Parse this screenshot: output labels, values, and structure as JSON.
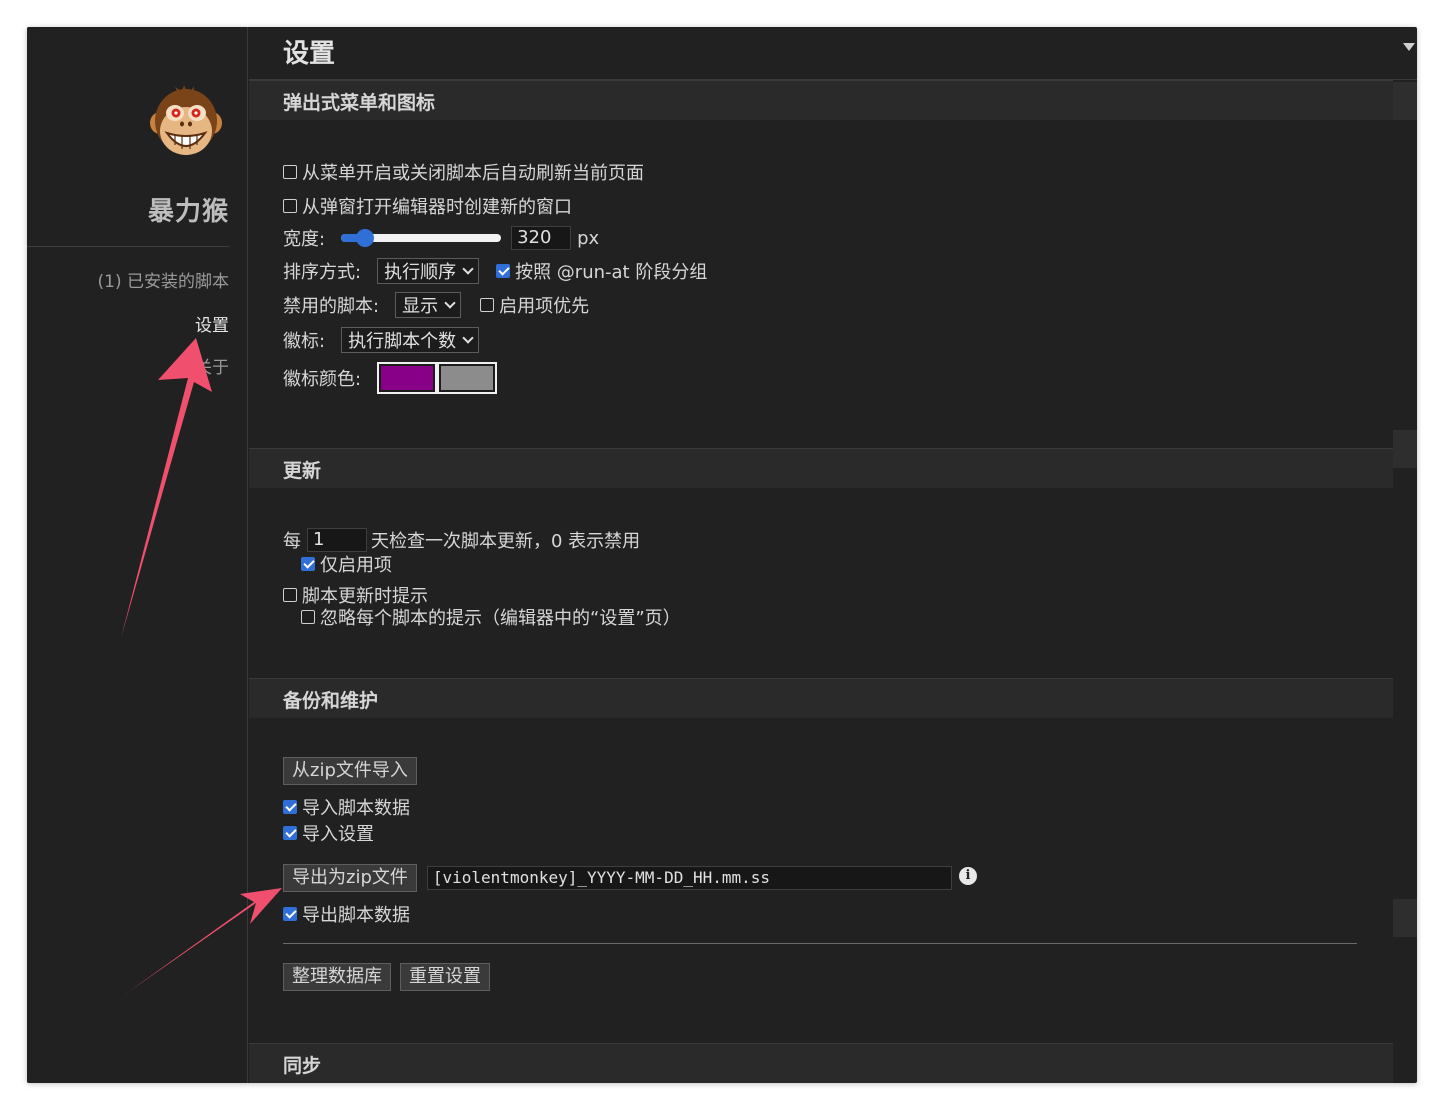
{
  "sidebar": {
    "brand": "暴力猴",
    "nav": [
      {
        "label": "(1) 已安装的脚本"
      },
      {
        "label": "设置"
      },
      {
        "label": "关于"
      }
    ]
  },
  "page": {
    "title": "设置"
  },
  "popup": {
    "title": "弹出式菜单和图标",
    "auto_refresh": "从菜单开启或关闭脚本后自动刷新当前页面",
    "new_window": "从弹窗打开编辑器时创建新的窗口",
    "width_label": "宽度:",
    "width_value": "320",
    "width_unit": "px",
    "width_fraction": 0.15,
    "sort_label": "排序方式:",
    "sort_value": "执行顺序",
    "group_runat": "按照 @run-at 阶段分组",
    "disabled_label": "禁用的脚本:",
    "disabled_value": "显示",
    "enabled_first": "启用项优先",
    "badge_label": "徽标:",
    "badge_value": "执行脚本个数",
    "badge_color_label": "徽标颜色:",
    "badge_colors": [
      "#880088",
      "#8c8c8c"
    ]
  },
  "update": {
    "title": "更新",
    "every": "每",
    "days_value": "1",
    "days_suffix": "天检查一次脚本更新，0 表示禁用",
    "enabled_only": "仅启用项",
    "notify": "脚本更新时提示",
    "ignore_each": "忽略每个脚本的提示（编辑器中的“设置”页）"
  },
  "backup": {
    "title": "备份和维护",
    "import_button": "从zip文件导入",
    "import_script_data": "导入脚本数据",
    "import_settings": "导入设置",
    "export_button": "导出为zip文件",
    "export_filename": "[violentmonkey]_YYYY-MM-DD_HH.mm.ss",
    "export_script_data": "导出脚本数据",
    "vacuum_button": "整理数据库",
    "reset_button": "重置设置"
  },
  "sync": {
    "title": "同步"
  },
  "icons": {
    "logo": "violentmonkey-logo",
    "info": "info-icon",
    "collapse": "caret-down-icon"
  },
  "colors": {
    "accent": "#2f6fd6",
    "annotation": "#f0506e",
    "background": "#212121"
  }
}
